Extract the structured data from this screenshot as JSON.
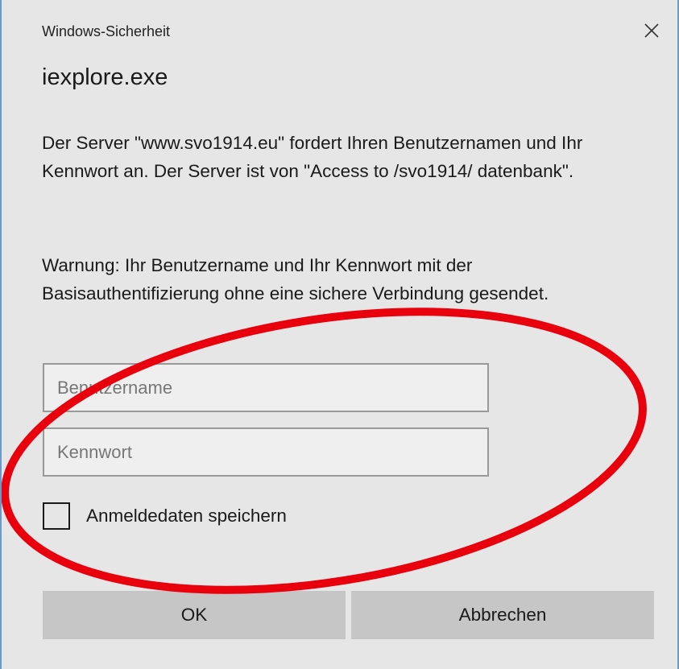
{
  "window": {
    "title": "Windows-Sicherheit",
    "close_icon": "close-icon"
  },
  "app_name": "iexplore.exe",
  "message": "Der Server \"www.svo1914.eu\" fordert Ihren Benutzernamen und Ihr Kennwort an. Der Server ist von \"Access to /svo1914/ datenbank\".",
  "warning": "Warnung: Ihr Benutzername und Ihr Kennwort mit der Basisauthentifizierung ohne eine sichere Verbindung gesendet.",
  "form": {
    "username_placeholder": "Benutzername",
    "password_placeholder": "Kennwort",
    "remember_label": "Anmeldedaten speichern",
    "remember_checked": false
  },
  "buttons": {
    "ok_label": "OK",
    "cancel_label": "Abbrechen"
  },
  "colors": {
    "background": "#e6e6e6",
    "button": "#c6c6c6",
    "annotation": "#e8000c",
    "window_border": "#6b9ac9"
  }
}
